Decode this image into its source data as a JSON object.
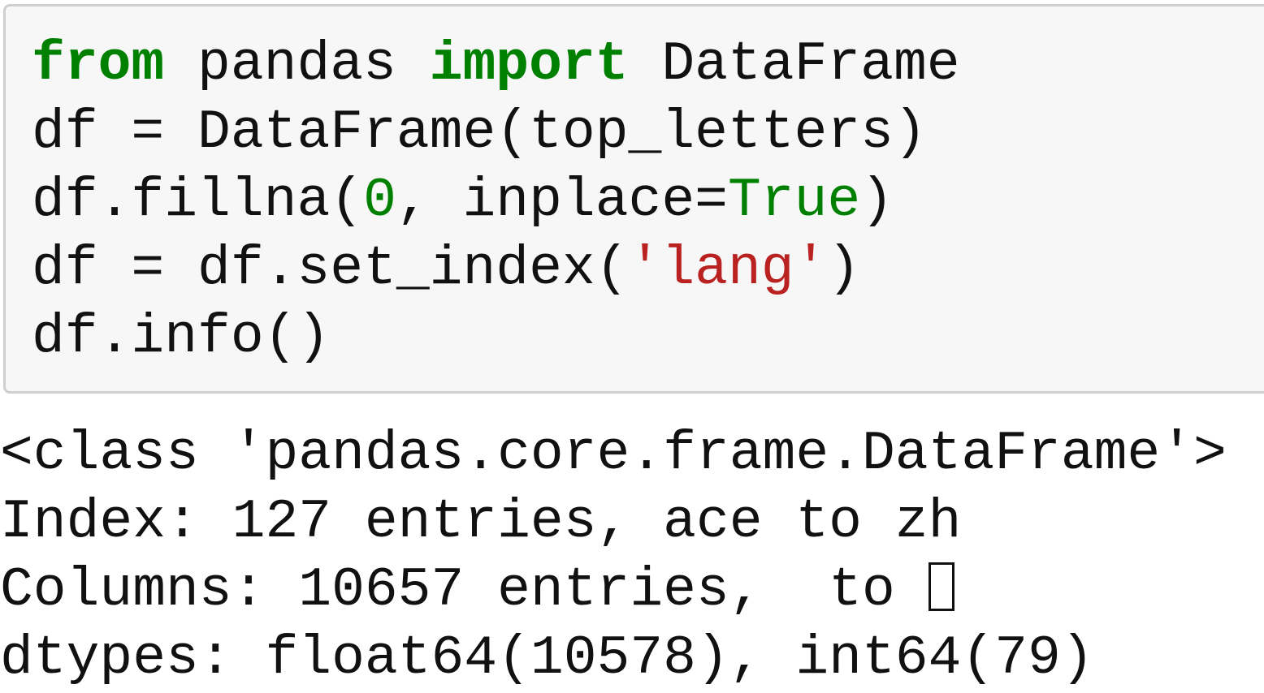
{
  "input_cell": {
    "line1": {
      "kw_from": "from",
      "module": " pandas ",
      "kw_import": "import",
      "name": " DataFrame"
    },
    "line2": "df = DataFrame(top_letters)",
    "line3": {
      "pre": "df.fillna(",
      "num": "0",
      "mid": ", inplace=",
      "bool": "True",
      "post": ")"
    },
    "line4": {
      "pre": "df = df.set_index(",
      "str": "'lang'",
      "post": ")"
    },
    "line5": "df.info()"
  },
  "output_cell": {
    "line1": "<class 'pandas.core.frame.DataFrame'>",
    "line2": "Index: 127 entries, ace to zh",
    "line3": "Columns: 10657 entries,  to ",
    "line3_icon": "missing-glyph-box",
    "line4": "dtypes: float64(10578), int64(79)"
  },
  "colors": {
    "keyword": "#008000",
    "string": "#ba2121",
    "cell_background": "#f7f7f7",
    "cell_border": "#cfcfcf"
  }
}
